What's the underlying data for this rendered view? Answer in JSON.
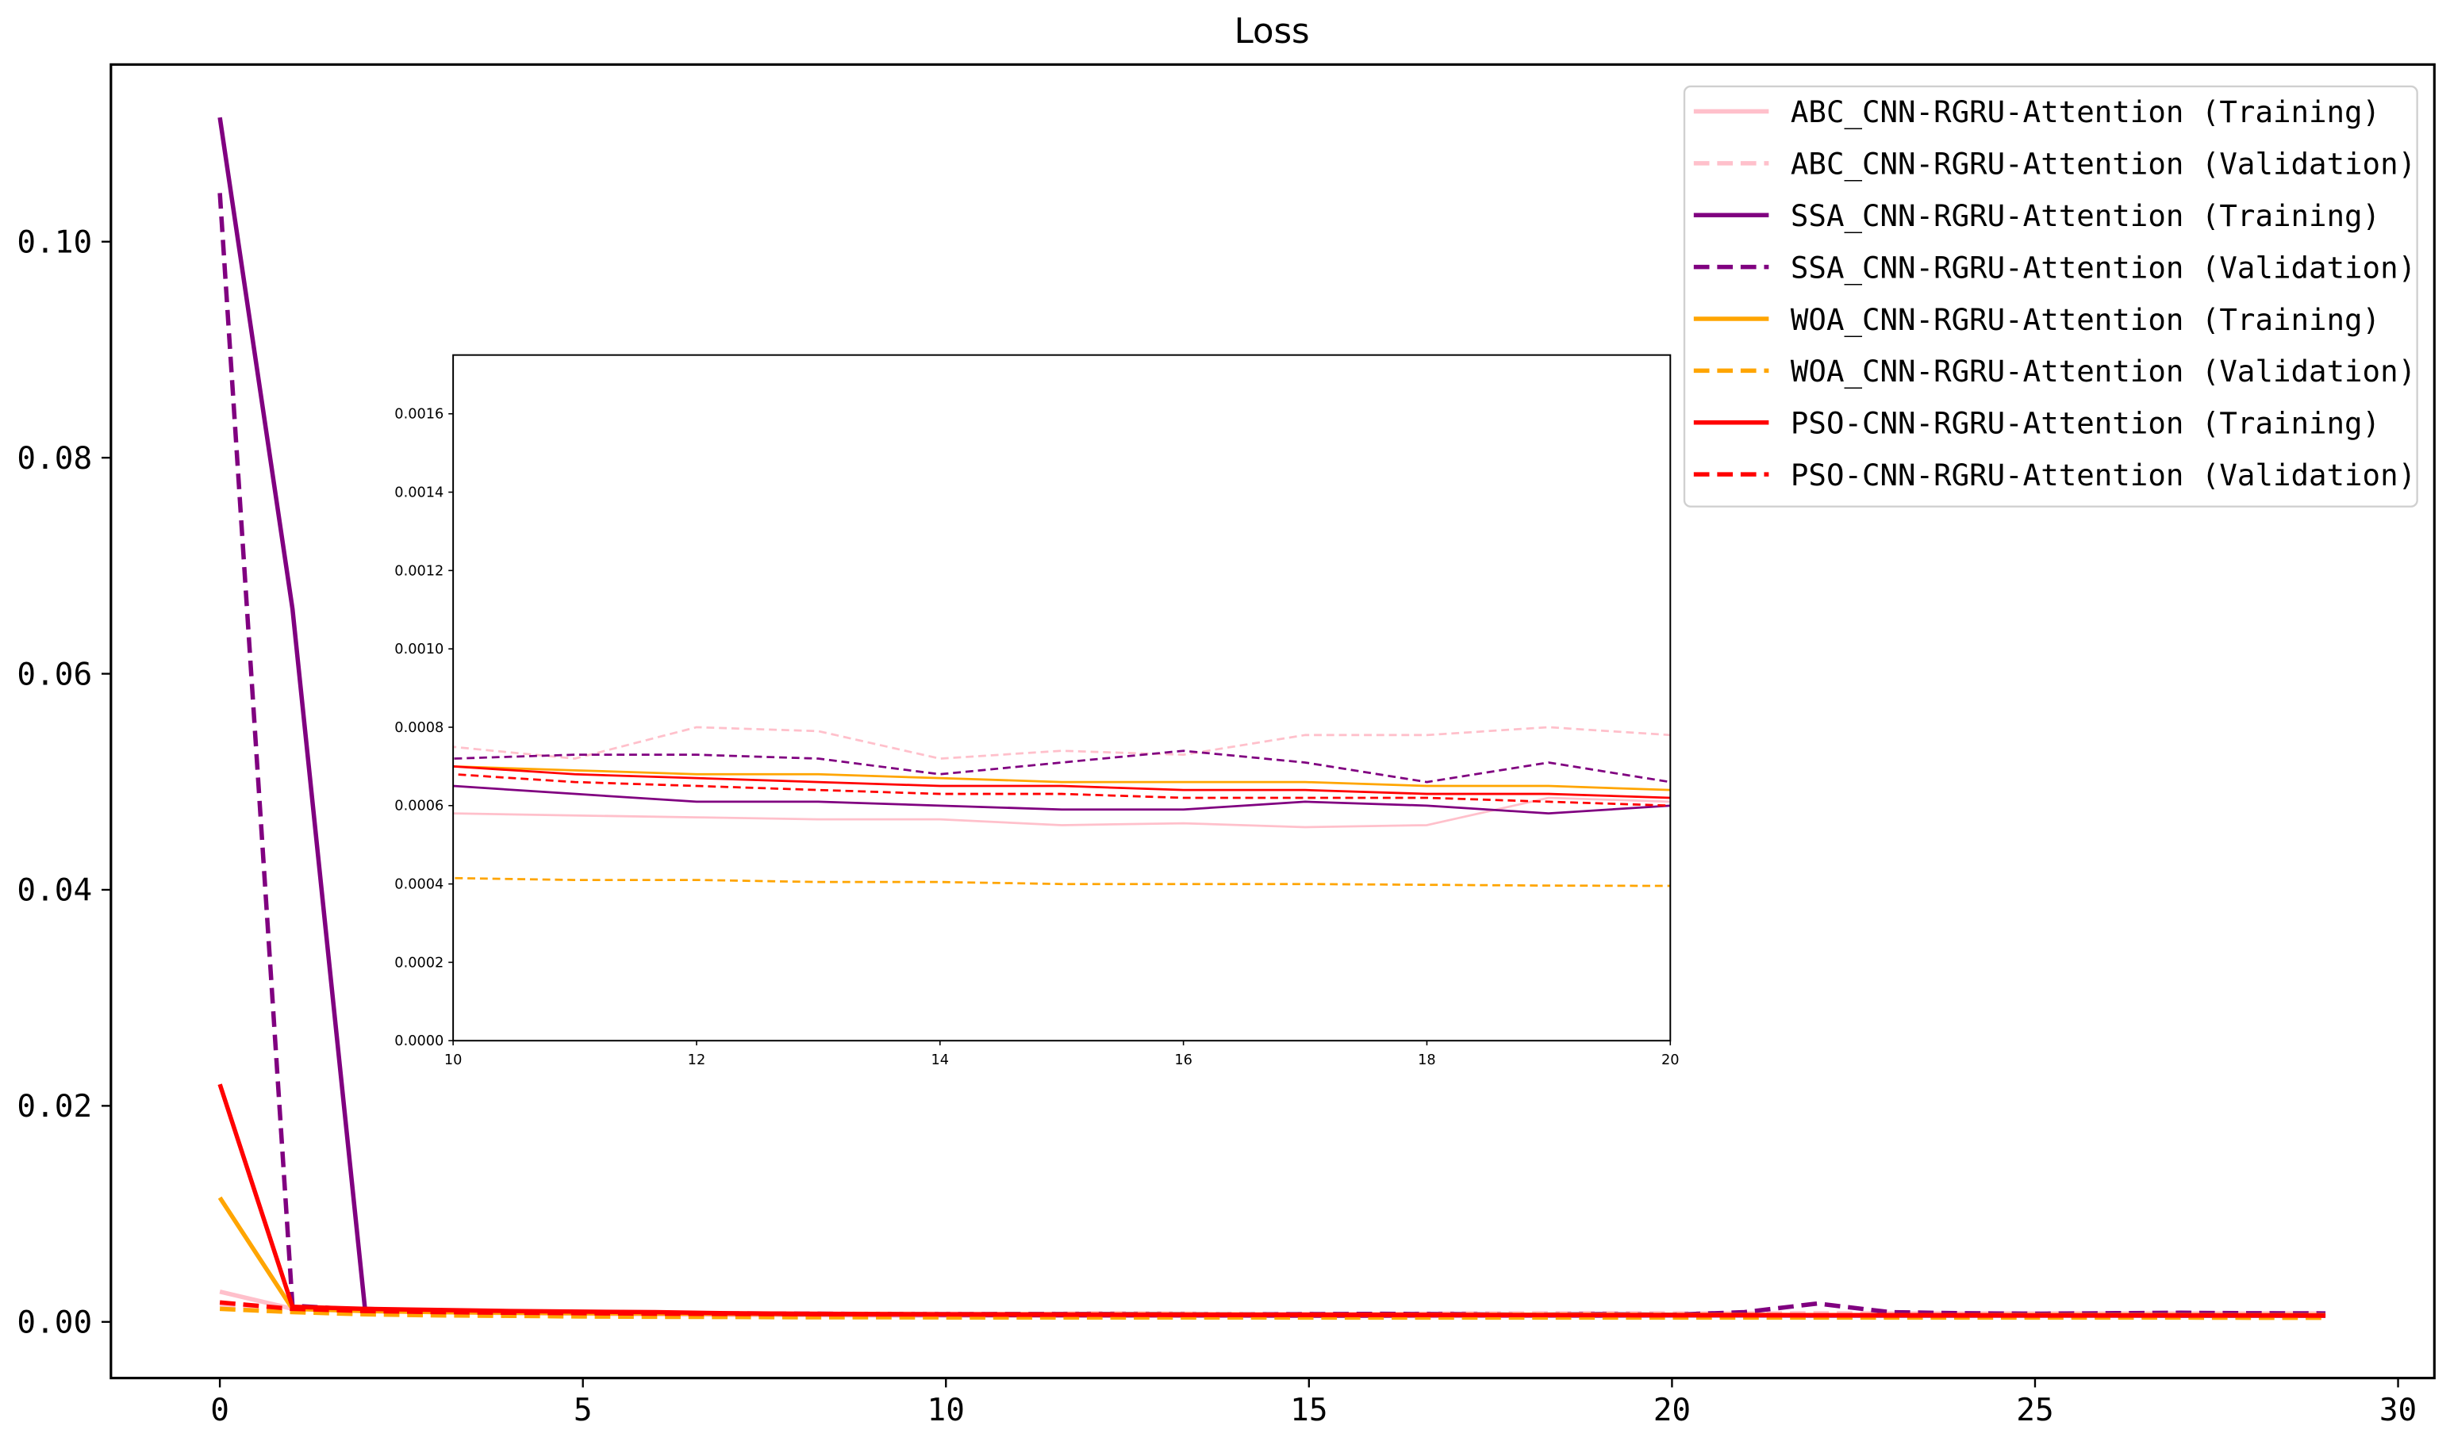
{
  "chart_data": {
    "type": "line",
    "title": "Loss",
    "xlabel": "",
    "ylabel": "",
    "xlim": [
      -1.5,
      30.5
    ],
    "ylim": [
      -0.0052,
      0.1164
    ],
    "xticks": [
      0,
      5,
      10,
      15,
      20,
      25,
      30
    ],
    "yticks": [
      0.0,
      0.02,
      0.04,
      0.06,
      0.08,
      0.1
    ],
    "xtick_labels": [
      "0",
      "5",
      "10",
      "15",
      "20",
      "25",
      "30"
    ],
    "ytick_labels": [
      "0.00",
      "0.02",
      "0.04",
      "0.06",
      "0.08",
      "0.10"
    ],
    "grid": false,
    "legend_position": "top-right",
    "x": [
      0,
      1,
      2,
      3,
      4,
      5,
      6,
      7,
      8,
      9,
      10,
      11,
      12,
      13,
      14,
      15,
      16,
      17,
      18,
      19,
      20,
      21,
      22,
      23,
      24,
      25,
      26,
      27,
      28,
      29
    ],
    "series": [
      {
        "name": "ABC_CNN-RGRU-Attention (Training)",
        "color": "#ffc0cb",
        "dash": false,
        "values": [
          0.0028,
          0.0012,
          0.001,
          0.0009,
          0.0008,
          0.00075,
          0.0007,
          0.00065,
          0.00062,
          0.0006,
          0.00058,
          0.000575,
          0.00057,
          0.000565,
          0.000565,
          0.00055,
          0.000555,
          0.000545,
          0.00055,
          0.00062,
          0.00061,
          0.0006,
          0.0006,
          0.00059,
          0.00059,
          0.00058,
          0.00058,
          0.00058,
          0.00057,
          0.00057
        ]
      },
      {
        "name": "ABC_CNN-RGRU-Attention (Validation)",
        "color": "#ffc0cb",
        "dash": true,
        "values": [
          0.0016,
          0.0011,
          0.001,
          0.0009,
          0.00085,
          0.0008,
          0.00078,
          0.00077,
          0.00076,
          0.00076,
          0.00075,
          0.00072,
          0.0008,
          0.00079,
          0.00072,
          0.00074,
          0.00073,
          0.00078,
          0.00078,
          0.0008,
          0.00078,
          0.00079,
          0.0008,
          0.00078,
          0.00079,
          0.00078,
          0.00078,
          0.00079,
          0.00078,
          0.00078
        ]
      },
      {
        "name": "SSA_CNN-RGRU-Attention (Training)",
        "color": "#800080",
        "dash": false,
        "values": [
          0.1115,
          0.066,
          0.0012,
          0.001,
          0.0009,
          0.00085,
          0.0008,
          0.00075,
          0.0007,
          0.00068,
          0.00065,
          0.00063,
          0.00061,
          0.00061,
          0.0006,
          0.00059,
          0.00059,
          0.00061,
          0.0006,
          0.00058,
          0.0006,
          0.0006,
          0.00059,
          0.00059,
          0.00058,
          0.00058,
          0.00058,
          0.00057,
          0.00057,
          0.00057
        ]
      },
      {
        "name": "SSA_CNN-RGRU-Attention (Validation)",
        "color": "#800080",
        "dash": true,
        "values": [
          0.1045,
          0.0015,
          0.0011,
          0.001,
          0.0009,
          0.00085,
          0.0008,
          0.00078,
          0.00075,
          0.00073,
          0.00072,
          0.00073,
          0.00073,
          0.00072,
          0.00068,
          0.00071,
          0.00074,
          0.00071,
          0.00066,
          0.00071,
          0.00066,
          0.0009,
          0.0017,
          0.0009,
          0.0008,
          0.00075,
          0.0008,
          0.00085,
          0.0008,
          0.00078
        ]
      },
      {
        "name": "WOA_CNN-RGRU-Attention (Training)",
        "color": "#ffa500",
        "dash": false,
        "values": [
          0.0115,
          0.0012,
          0.001,
          0.0009,
          0.00085,
          0.0008,
          0.00078,
          0.00075,
          0.00073,
          0.00072,
          0.0007,
          0.00069,
          0.00068,
          0.00068,
          0.00067,
          0.00066,
          0.00066,
          0.00066,
          0.00065,
          0.00065,
          0.00064,
          0.00064,
          0.00063,
          0.00063,
          0.00063,
          0.00062,
          0.00062,
          0.00062,
          0.00061,
          0.00061
        ]
      },
      {
        "name": "WOA_CNN-RGRU-Attention (Validation)",
        "color": "#ffa500",
        "dash": true,
        "values": [
          0.0012,
          0.0009,
          0.0007,
          0.0006,
          0.00055,
          0.0005,
          0.00047,
          0.00045,
          0.00043,
          0.00042,
          0.000415,
          0.00041,
          0.00041,
          0.000405,
          0.000405,
          0.0004,
          0.0004,
          0.0004,
          0.000398,
          0.000396,
          0.000395,
          0.000394,
          0.000393,
          0.000392,
          0.000391,
          0.00039,
          0.00039,
          0.000389,
          0.000388,
          0.000388
        ]
      },
      {
        "name": "PSO-CNN-RGRU-Attention (Training)",
        "color": "#ff0000",
        "dash": false,
        "values": [
          0.022,
          0.0014,
          0.0012,
          0.0011,
          0.001,
          0.00095,
          0.0009,
          0.0008,
          0.00075,
          0.00072,
          0.0007,
          0.00068,
          0.00067,
          0.00066,
          0.00065,
          0.00065,
          0.00064,
          0.00064,
          0.00063,
          0.00063,
          0.00062,
          0.00062,
          0.00061,
          0.00061,
          0.00061,
          0.0006,
          0.0006,
          0.0006,
          0.0006,
          0.00059
        ]
      },
      {
        "name": "PSO-CNN-RGRU-Attention (Validation)",
        "color": "#ff0000",
        "dash": true,
        "values": [
          0.0018,
          0.0012,
          0.001,
          0.0009,
          0.00085,
          0.0008,
          0.00076,
          0.00073,
          0.0007,
          0.00069,
          0.00068,
          0.00066,
          0.00065,
          0.00064,
          0.00063,
          0.00063,
          0.00062,
          0.00062,
          0.00062,
          0.00061,
          0.0006,
          0.0006,
          0.0006,
          0.00059,
          0.00059,
          0.00059,
          0.00058,
          0.00058,
          0.00058,
          0.00058
        ]
      }
    ],
    "inset": {
      "xlim": [
        10,
        20
      ],
      "ylim": [
        0,
        0.00175
      ],
      "xticks": [
        10,
        12,
        14,
        16,
        18,
        20
      ],
      "yticks": [
        0,
        0.0002,
        0.0004,
        0.0006,
        0.0008,
        0.001,
        0.0012,
        0.0014,
        0.0016
      ],
      "xtick_labels": [
        "10",
        "12",
        "14",
        "16",
        "18",
        "20"
      ],
      "ytick_labels": [
        "0.0000",
        "0.0002",
        "0.0004",
        "0.0006",
        "0.0008",
        "0.0010",
        "0.0012",
        "0.0014",
        "0.0016"
      ]
    }
  }
}
